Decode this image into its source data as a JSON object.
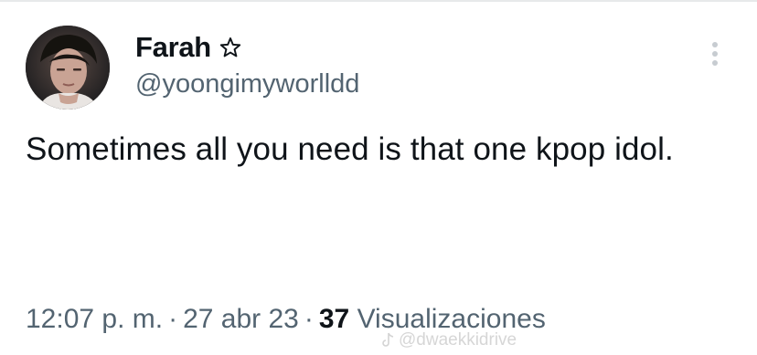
{
  "tweet": {
    "author_name": "Farah",
    "author_handle": "@yoongimyworlldd",
    "author_badge_icon": "star-icon",
    "text": "Sometimes all you need is that one kpop idol.",
    "time": "12:07 p. m.",
    "separator": "·",
    "date": "27 abr 23",
    "views_count": "37",
    "views_label": "Visualizaciones"
  },
  "overlay": {
    "watermark_text": "@dwaekkidrive",
    "watermark_icon": "tiktok-icon"
  },
  "colors": {
    "text_primary": "#0f1419",
    "text_secondary": "#536471",
    "background": "#ffffff"
  }
}
